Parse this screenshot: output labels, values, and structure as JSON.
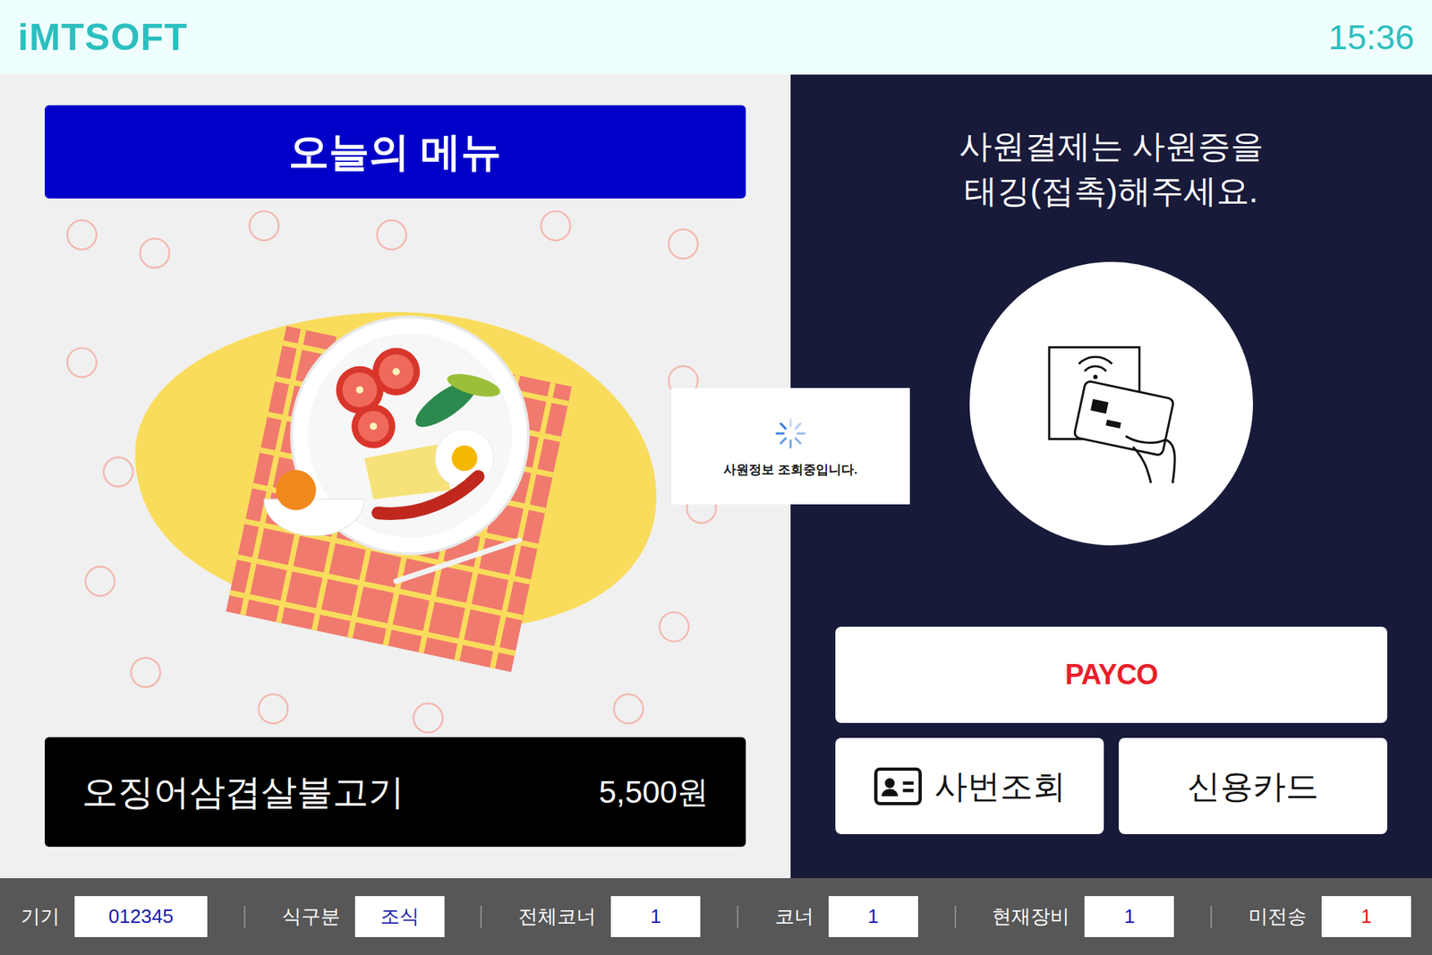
{
  "header": {
    "logo": "iMTSOFT",
    "time": "15:36"
  },
  "menu": {
    "title": "오늘의 메뉴",
    "name": "오징어삼겹살불고기",
    "price": "5,500원"
  },
  "loading": {
    "message": "사원정보 조회중입니다."
  },
  "payment": {
    "instruction": [
      "사원결제는 사원증을",
      "태깅(접촉)해주세요."
    ],
    "buttons": [
      {
        "label": "PAYCO",
        "kind": "brand"
      },
      {
        "label": "사번조회",
        "kind": "icon"
      },
      {
        "label": "신용카드",
        "kind": "plain"
      }
    ]
  },
  "status_bar": [
    {
      "label": "기기",
      "value": "012345",
      "color": "#1a1ab0"
    },
    {
      "label": "식구분",
      "value": "조식",
      "color": "#1a1ab0"
    },
    {
      "label": "전체코너",
      "value": "1",
      "color": "#1a1ab0"
    },
    {
      "label": "코너",
      "value": "1",
      "color": "#1a1ab0"
    },
    {
      "label": "현재장비",
      "value": "1",
      "color": "#1a1ab0"
    },
    {
      "label": "미전송",
      "value": "1",
      "color": "#e0141e"
    }
  ]
}
